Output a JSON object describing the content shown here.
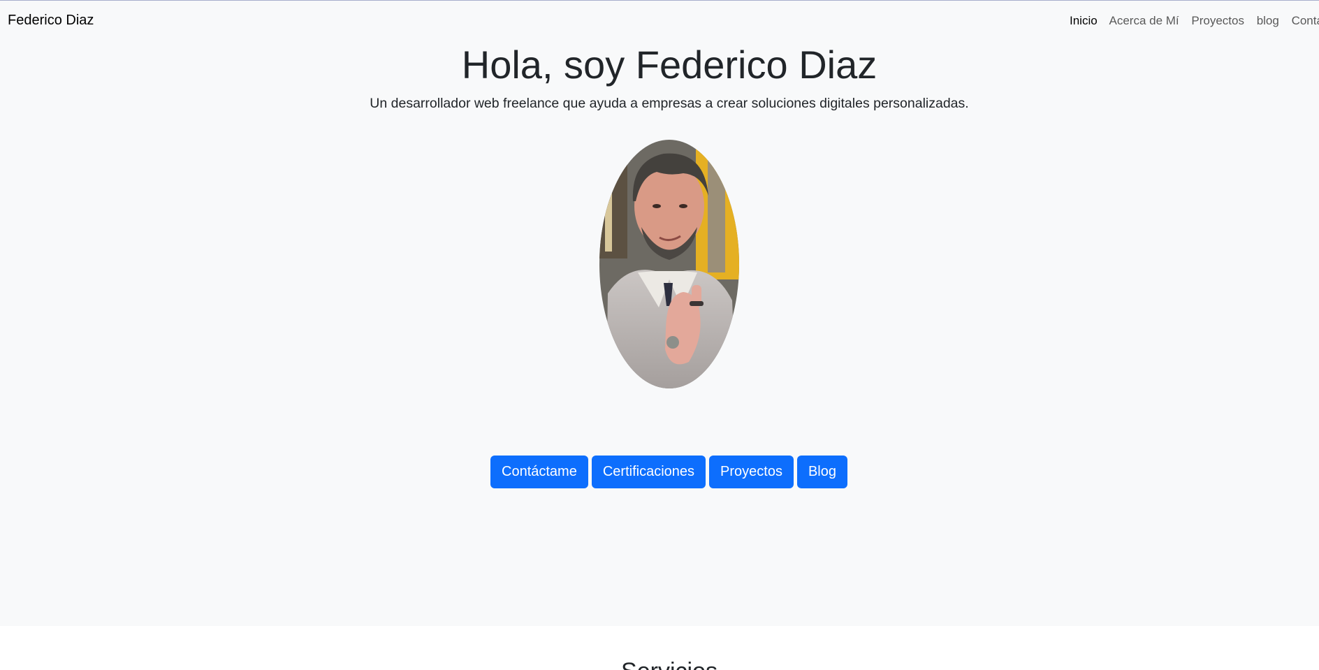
{
  "navbar": {
    "brand": "Federico Diaz",
    "links": [
      "Inicio",
      "Acerca de Mí",
      "Proyectos",
      "blog",
      "Contact"
    ]
  },
  "hero": {
    "title": "Hola, soy Federico Diaz",
    "lead": "Un desarrollador web freelance que ayuda a empresas a crear soluciones digitales personalizadas.",
    "avatar_alt": "Federico Diaz",
    "buttons": [
      "Contáctame",
      "Certificaciones",
      "Proyectos",
      "Blog"
    ]
  },
  "services": {
    "title": "Servicios"
  },
  "colors": {
    "primary": "#0d6efd",
    "hero_background": "#f8f9fa",
    "text": "#212529"
  }
}
